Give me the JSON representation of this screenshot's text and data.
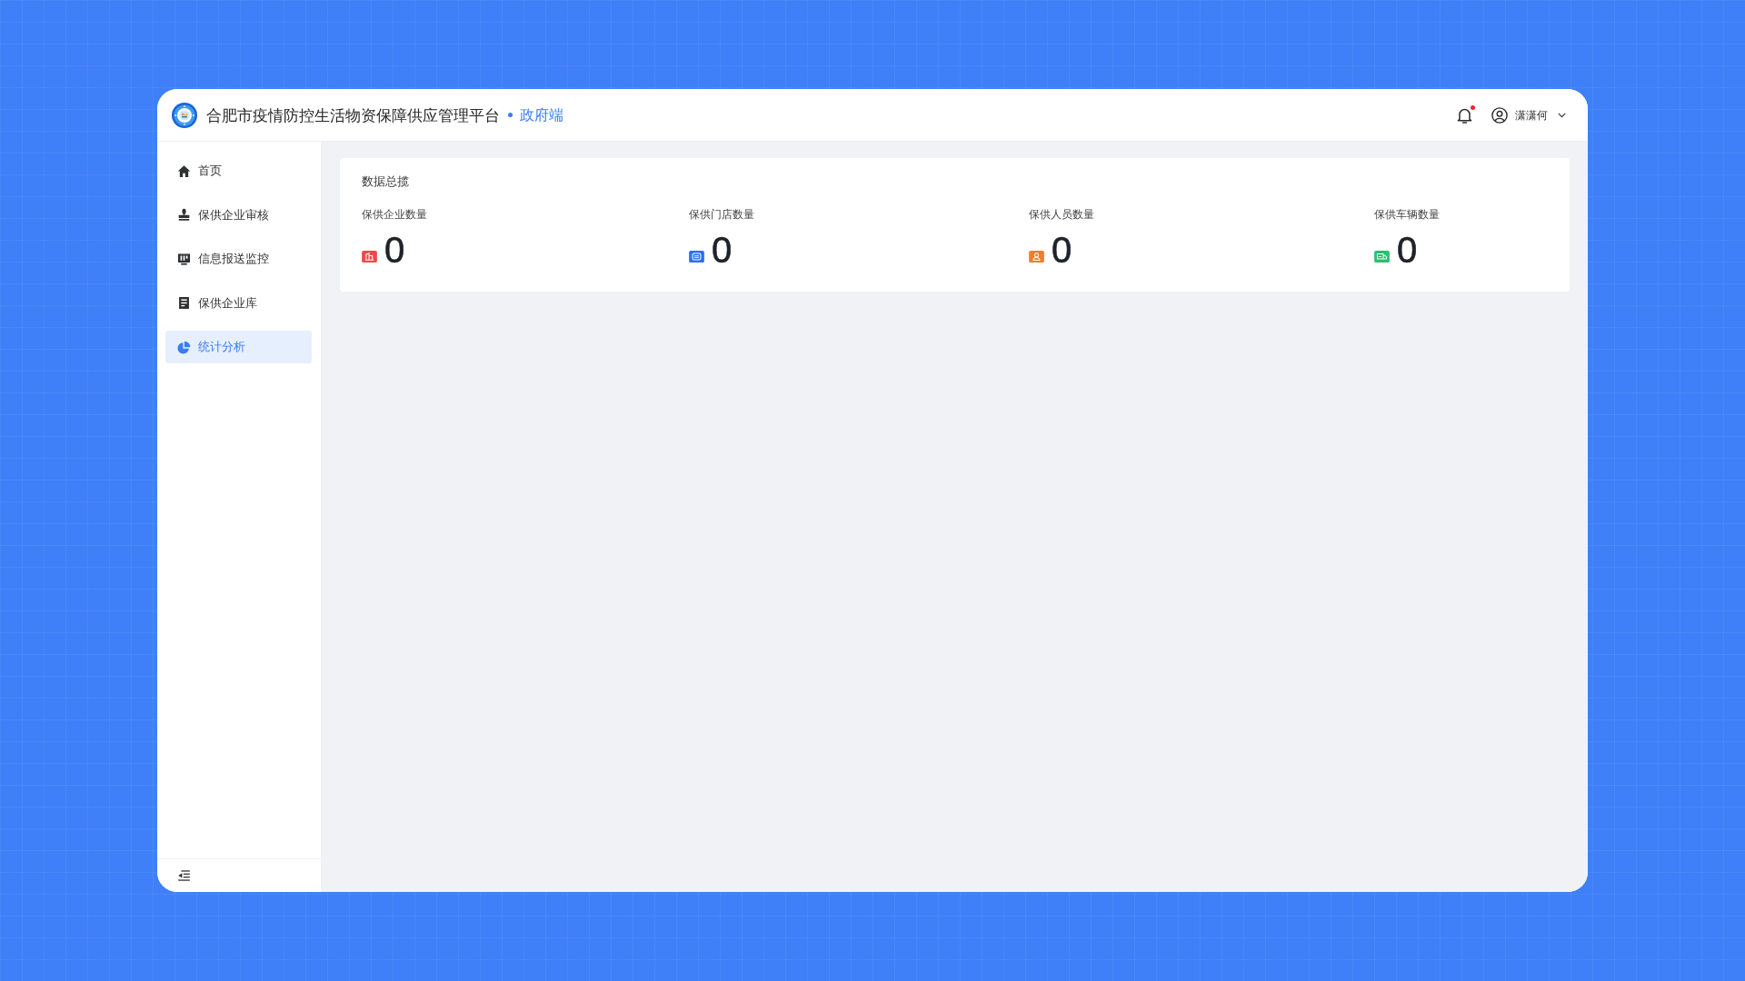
{
  "header": {
    "title": "合肥市疫情防控生活物资保障供应管理平台",
    "subtitle": "政府端",
    "notifications": {
      "unread": true
    },
    "user": {
      "name": "潇潇何"
    }
  },
  "sidebar": {
    "items": [
      {
        "label": "首页",
        "selected": false
      },
      {
        "label": "保供企业审核",
        "selected": false
      },
      {
        "label": "信息报送监控",
        "selected": false
      },
      {
        "label": "保供企业库",
        "selected": false
      },
      {
        "label": "统计分析",
        "selected": true
      }
    ]
  },
  "overview": {
    "title": "数据总揽",
    "stats": [
      {
        "label": "保供企业数量",
        "value": "0",
        "color": "#f04848"
      },
      {
        "label": "保供门店数量",
        "value": "0",
        "color": "#2d6ef6"
      },
      {
        "label": "保供人员数量",
        "value": "0",
        "color": "#f57c28"
      },
      {
        "label": "保供车辆数量",
        "value": "0",
        "color": "#25c16f"
      }
    ]
  }
}
